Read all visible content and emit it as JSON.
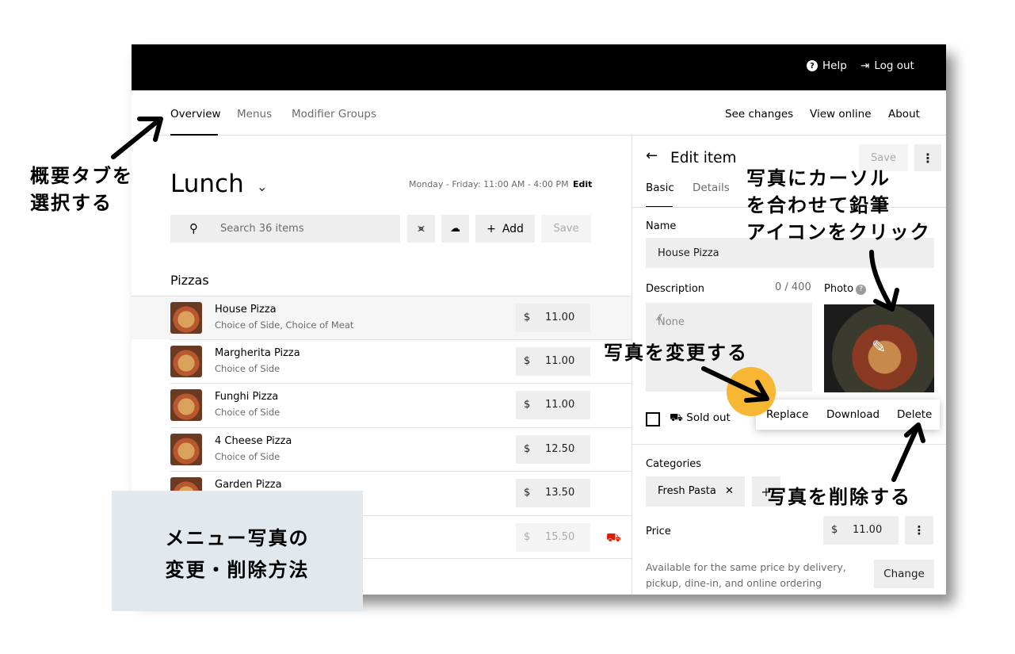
{
  "topbar": {
    "help": "Help",
    "logout": "Log out"
  },
  "nav": {
    "tabs": [
      "Overview",
      "Menus",
      "Modifier Groups"
    ],
    "links": [
      "See changes",
      "View online",
      "About"
    ]
  },
  "menu": {
    "title": "Lunch",
    "hours": "Monday - Friday: 11:00 AM - 4:00 PM",
    "hours_edit": "Edit",
    "search_placeholder": "Search 36 items",
    "add_label": "Add",
    "save_label": "Save",
    "section": "Pizzas",
    "items": [
      {
        "name": "House Pizza",
        "sub": "Choice of Side, Choice of Meat",
        "currency": "$",
        "price": "11.00"
      },
      {
        "name": "Margherita Pizza",
        "sub": "Choice of Side",
        "currency": "$",
        "price": "11.00"
      },
      {
        "name": "Funghi Pizza",
        "sub": "Choice of Side",
        "currency": "$",
        "price": "11.00"
      },
      {
        "name": "4 Cheese Pizza",
        "sub": "Choice of Side",
        "currency": "$",
        "price": "12.50"
      },
      {
        "name": "Garden Pizza",
        "sub": "",
        "currency": "$",
        "price": "13.50"
      },
      {
        "name": "",
        "sub": "",
        "currency": "$",
        "price": "15.50"
      }
    ]
  },
  "edit": {
    "title": "Edit item",
    "save": "Save",
    "tabs": [
      "Basic",
      "Details"
    ],
    "name_label": "Name",
    "name_value": "House Pizza",
    "desc_label": "Description",
    "desc_counter": "0 / 400",
    "desc_placeholder": "None",
    "photo_label": "Photo",
    "sold_out": "Sold out",
    "popup": [
      "Replace",
      "Download",
      "Delete"
    ],
    "categories_label": "Categories",
    "category": "Fresh Pasta",
    "price_label": "Price",
    "price_currency": "$",
    "price_value": "11.00",
    "availability": "Available for the same price by delivery, pickup, dine-in, and online ordering",
    "change": "Change"
  },
  "annotations": {
    "overview_tab": [
      "概要タブを",
      "選択する"
    ],
    "hover_photo": [
      "写真にカーソル",
      "を合わせて鉛筆",
      "アイコンをクリック"
    ],
    "change_photo": "写真を変更する",
    "delete_photo": "写真を削除する",
    "caption": [
      "メニュー写真の",
      "変更・削除方法"
    ]
  },
  "colors": {
    "topbar": "#000000",
    "caption_bg": "#e1e9ef",
    "highlight": "#f7b634",
    "sold_out_red": "#e11900"
  }
}
